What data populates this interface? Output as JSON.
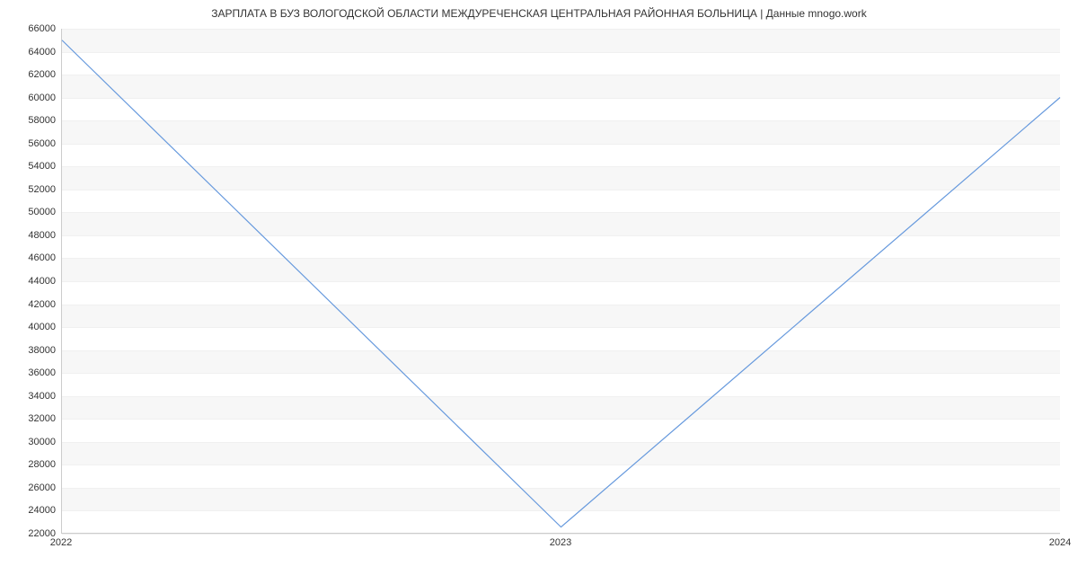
{
  "chart_data": {
    "type": "line",
    "title": "ЗАРПЛАТА В БУЗ ВОЛОГОДСКОЙ ОБЛАСТИ  МЕЖДУРЕЧЕНСКАЯ ЦЕНТРАЛЬНАЯ РАЙОННАЯ БОЛЬНИЦА | Данные mnogo.work",
    "x": [
      2022,
      2023,
      2024
    ],
    "values": [
      65000,
      22500,
      60000
    ],
    "x_ticks": [
      2022,
      2023,
      2024
    ],
    "y_ticks": [
      22000,
      24000,
      26000,
      28000,
      30000,
      32000,
      34000,
      36000,
      38000,
      40000,
      42000,
      44000,
      46000,
      48000,
      50000,
      52000,
      54000,
      56000,
      58000,
      60000,
      62000,
      64000,
      66000
    ],
    "ylim": [
      22000,
      66000
    ],
    "xlim": [
      2022,
      2024
    ],
    "line_color": "#6699dd",
    "xlabel": "",
    "ylabel": ""
  }
}
